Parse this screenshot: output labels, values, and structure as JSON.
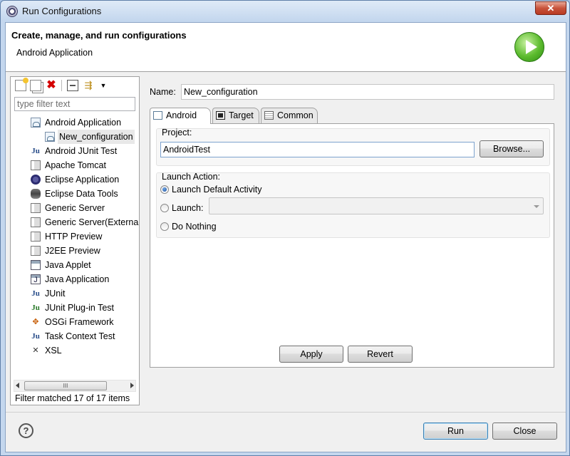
{
  "window": {
    "title": "Run Configurations",
    "close_glyph": "✕"
  },
  "banner": {
    "title": "Create, manage, and run configurations",
    "subtitle": "Android Application",
    "icon": "run-icon"
  },
  "left": {
    "toolbar": {
      "new_icon": "new-launch-config-icon",
      "duplicate_icon": "duplicate-icon",
      "delete_icon": "delete-icon",
      "delete_glyph": "✖",
      "collapse_icon": "collapse-all-icon",
      "filter_icon": "filter-icon",
      "filter_glyph": "⇶",
      "menu_glyph": "▼"
    },
    "filter_placeholder": "type filter text",
    "tree": [
      {
        "label": "Android Application",
        "icon": "android-app-icon",
        "level": 0
      },
      {
        "label": "New_configuration",
        "icon": "android-app-icon",
        "level": 1,
        "selected": true
      },
      {
        "label": "Android JUnit Test",
        "icon": "junit-icon",
        "level": 0
      },
      {
        "label": "Apache Tomcat",
        "icon": "server-icon",
        "level": 0
      },
      {
        "label": "Eclipse Application",
        "icon": "eclipse-icon",
        "level": 0
      },
      {
        "label": "Eclipse Data Tools",
        "icon": "database-icon",
        "level": 0
      },
      {
        "label": "Generic Server",
        "icon": "server-icon",
        "level": 0
      },
      {
        "label": "Generic Server(Externa",
        "icon": "server-icon",
        "level": 0
      },
      {
        "label": "HTTP Preview",
        "icon": "server-icon",
        "level": 0
      },
      {
        "label": "J2EE Preview",
        "icon": "server-icon",
        "level": 0
      },
      {
        "label": "Java Applet",
        "icon": "applet-icon",
        "level": 0
      },
      {
        "label": "Java Application",
        "icon": "java-app-icon",
        "level": 0
      },
      {
        "label": "JUnit",
        "icon": "junit-icon",
        "level": 0
      },
      {
        "label": "JUnit Plug-in Test",
        "icon": "junit-plugin-icon",
        "level": 0
      },
      {
        "label": "OSGi Framework",
        "icon": "osgi-icon",
        "level": 0
      },
      {
        "label": "Task Context Test",
        "icon": "junit-icon",
        "level": 0
      },
      {
        "label": "XSL",
        "icon": "xsl-icon",
        "level": 0
      }
    ],
    "scroll_grip": "III",
    "status": "Filter matched 17 of 17 items"
  },
  "right": {
    "name_label": "Name:",
    "name_value": "New_configuration",
    "tabs": [
      {
        "label": "Android",
        "icon": "android-tab-icon",
        "active": true
      },
      {
        "label": "Target",
        "icon": "target-tab-icon",
        "active": false
      },
      {
        "label": "Common",
        "icon": "common-tab-icon",
        "active": false
      }
    ],
    "project_group_label": "Project:",
    "project_value": "AndroidTest",
    "browse_label": "Browse...",
    "launch_group_label": "Launch Action:",
    "radios": [
      {
        "label": "Launch Default Activity",
        "checked": true
      },
      {
        "label": "Launch:",
        "checked": false
      },
      {
        "label": "Do Nothing",
        "checked": false
      }
    ],
    "launch_select_value": "",
    "apply_label": "Apply",
    "revert_label": "Revert"
  },
  "footer": {
    "help_glyph": "?",
    "run_label": "Run",
    "close_label": "Close"
  }
}
